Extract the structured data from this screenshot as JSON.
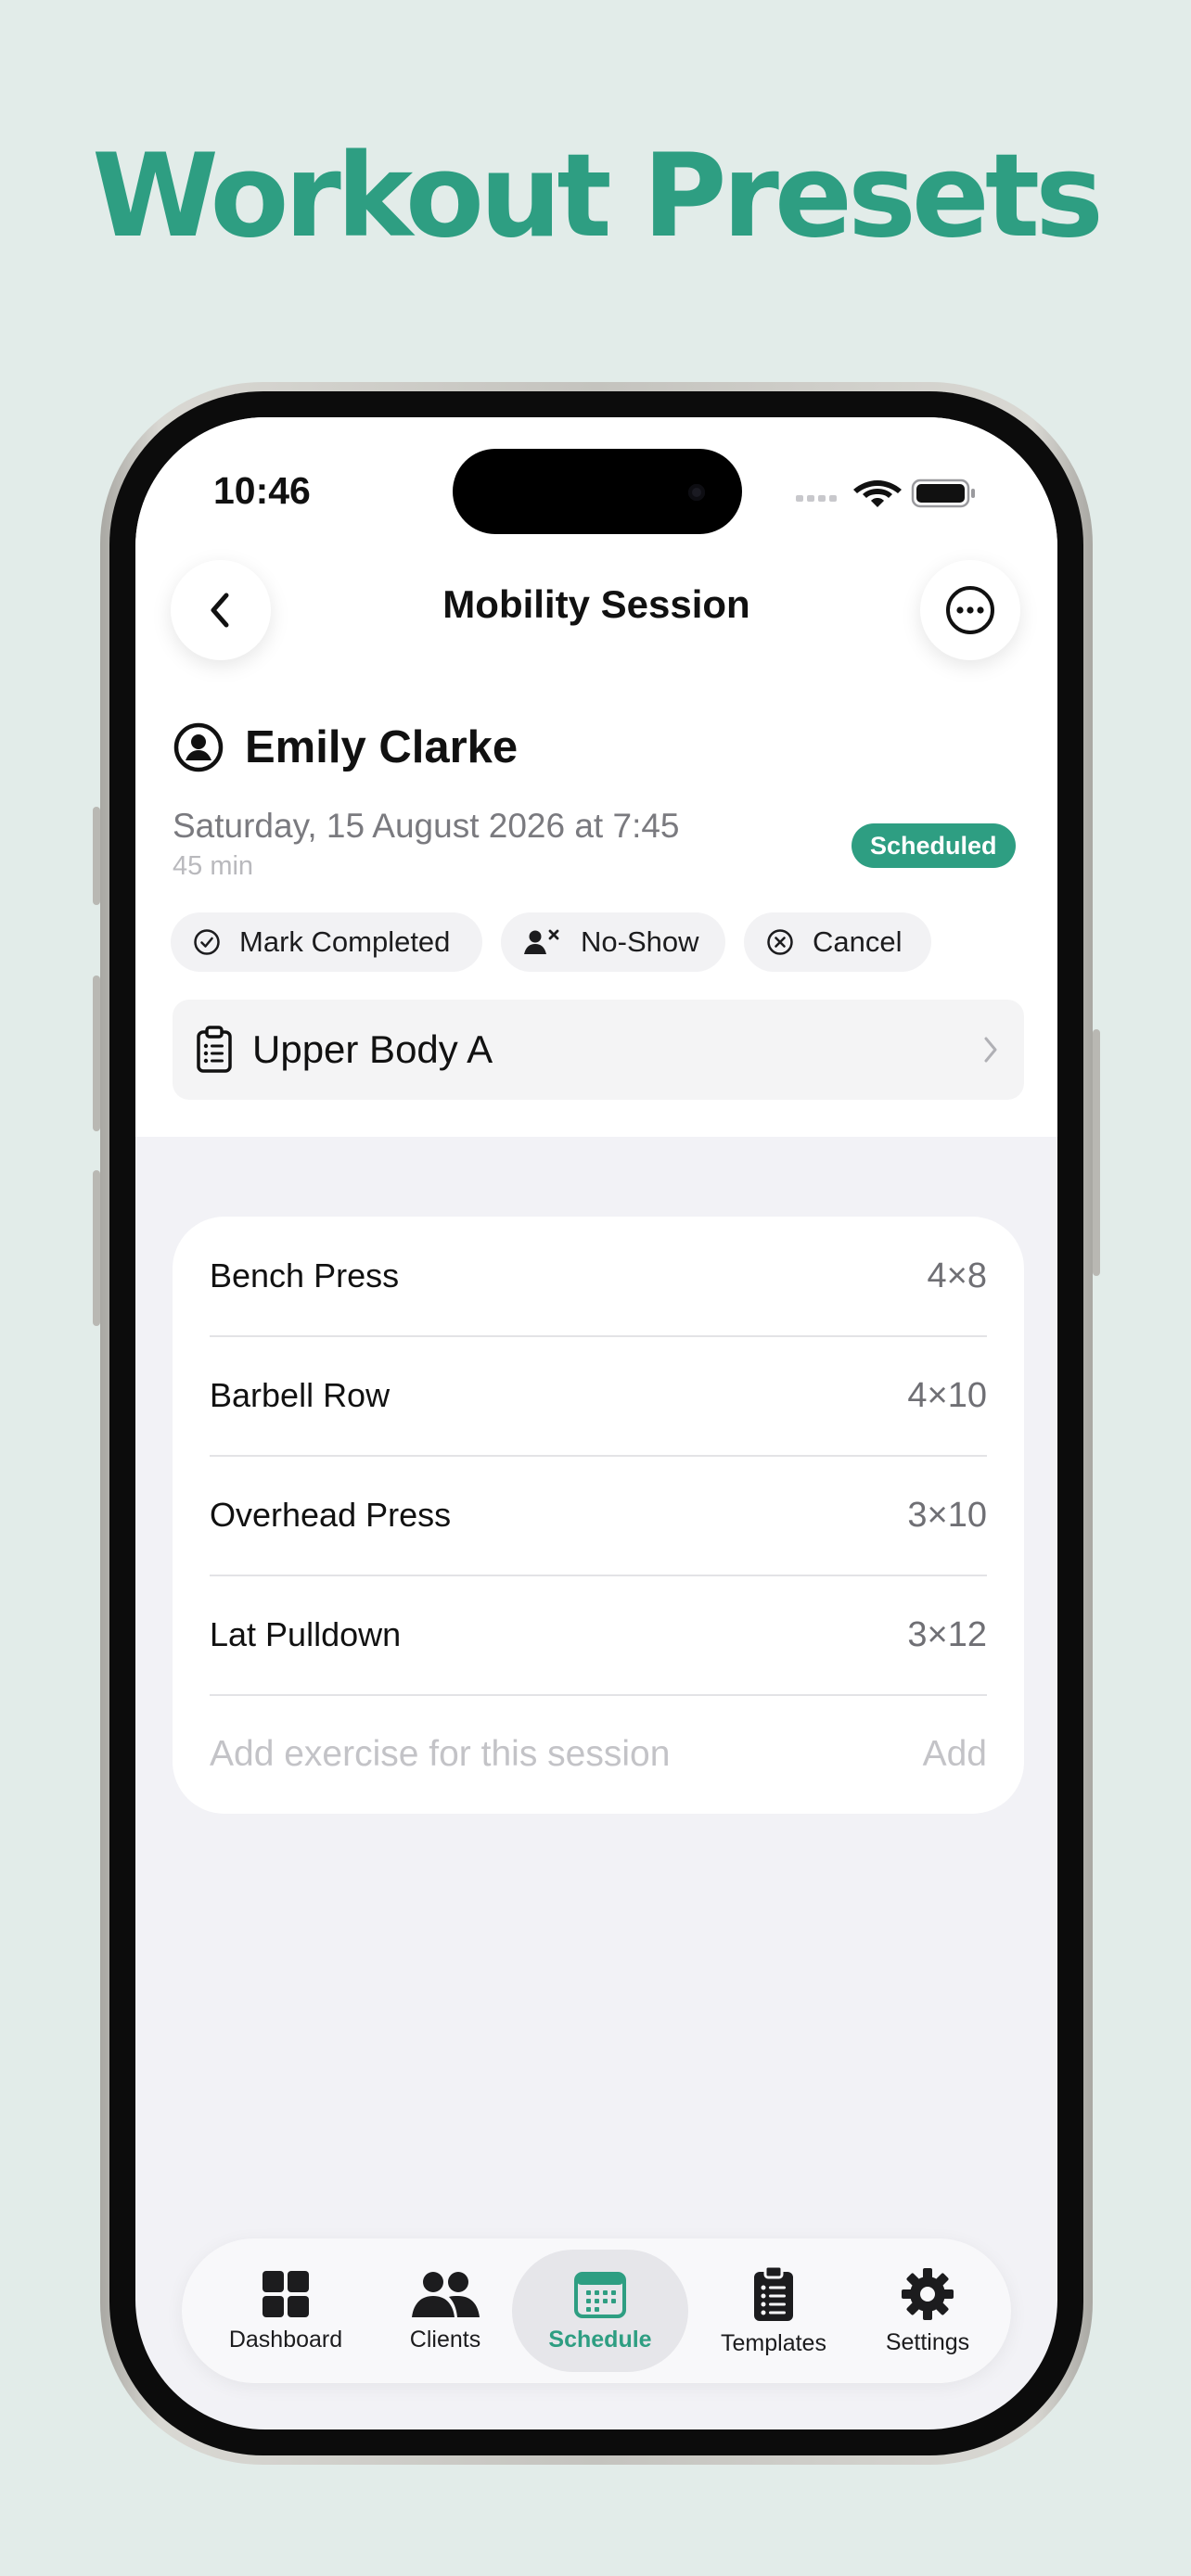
{
  "headline": "Workout Presets",
  "status_bar": {
    "time": "10:46"
  },
  "nav": {
    "title": "Mobility Session",
    "back_icon": "chevron-left-icon",
    "more_icon": "ellipsis-circle-icon"
  },
  "session": {
    "client_name": "Emily Clarke",
    "date": "Saturday, 15 August 2026 at 7:45",
    "duration": "45 min",
    "status": "Scheduled",
    "status_color": "#2e9e82"
  },
  "actions": {
    "mark_completed": "Mark Completed",
    "no_show": "No-Show",
    "cancel": "Cancel"
  },
  "template": {
    "name": "Upper Body A"
  },
  "exercises": [
    {
      "name": "Bench Press",
      "sets": "4×8"
    },
    {
      "name": "Barbell Row",
      "sets": "4×10"
    },
    {
      "name": "Overhead Press",
      "sets": "3×10"
    },
    {
      "name": "Lat Pulldown",
      "sets": "3×12"
    }
  ],
  "add_exercise": {
    "placeholder": "Add exercise for this session",
    "button": "Add"
  },
  "tabs": [
    {
      "label": "Dashboard",
      "icon": "grid-icon"
    },
    {
      "label": "Clients",
      "icon": "people-icon"
    },
    {
      "label": "Schedule",
      "icon": "calendar-icon",
      "active": true
    },
    {
      "label": "Templates",
      "icon": "clipboard-list-icon"
    },
    {
      "label": "Settings",
      "icon": "gear-icon"
    }
  ],
  "colors": {
    "accent": "#2e9e82",
    "background": "#e2ece9"
  }
}
